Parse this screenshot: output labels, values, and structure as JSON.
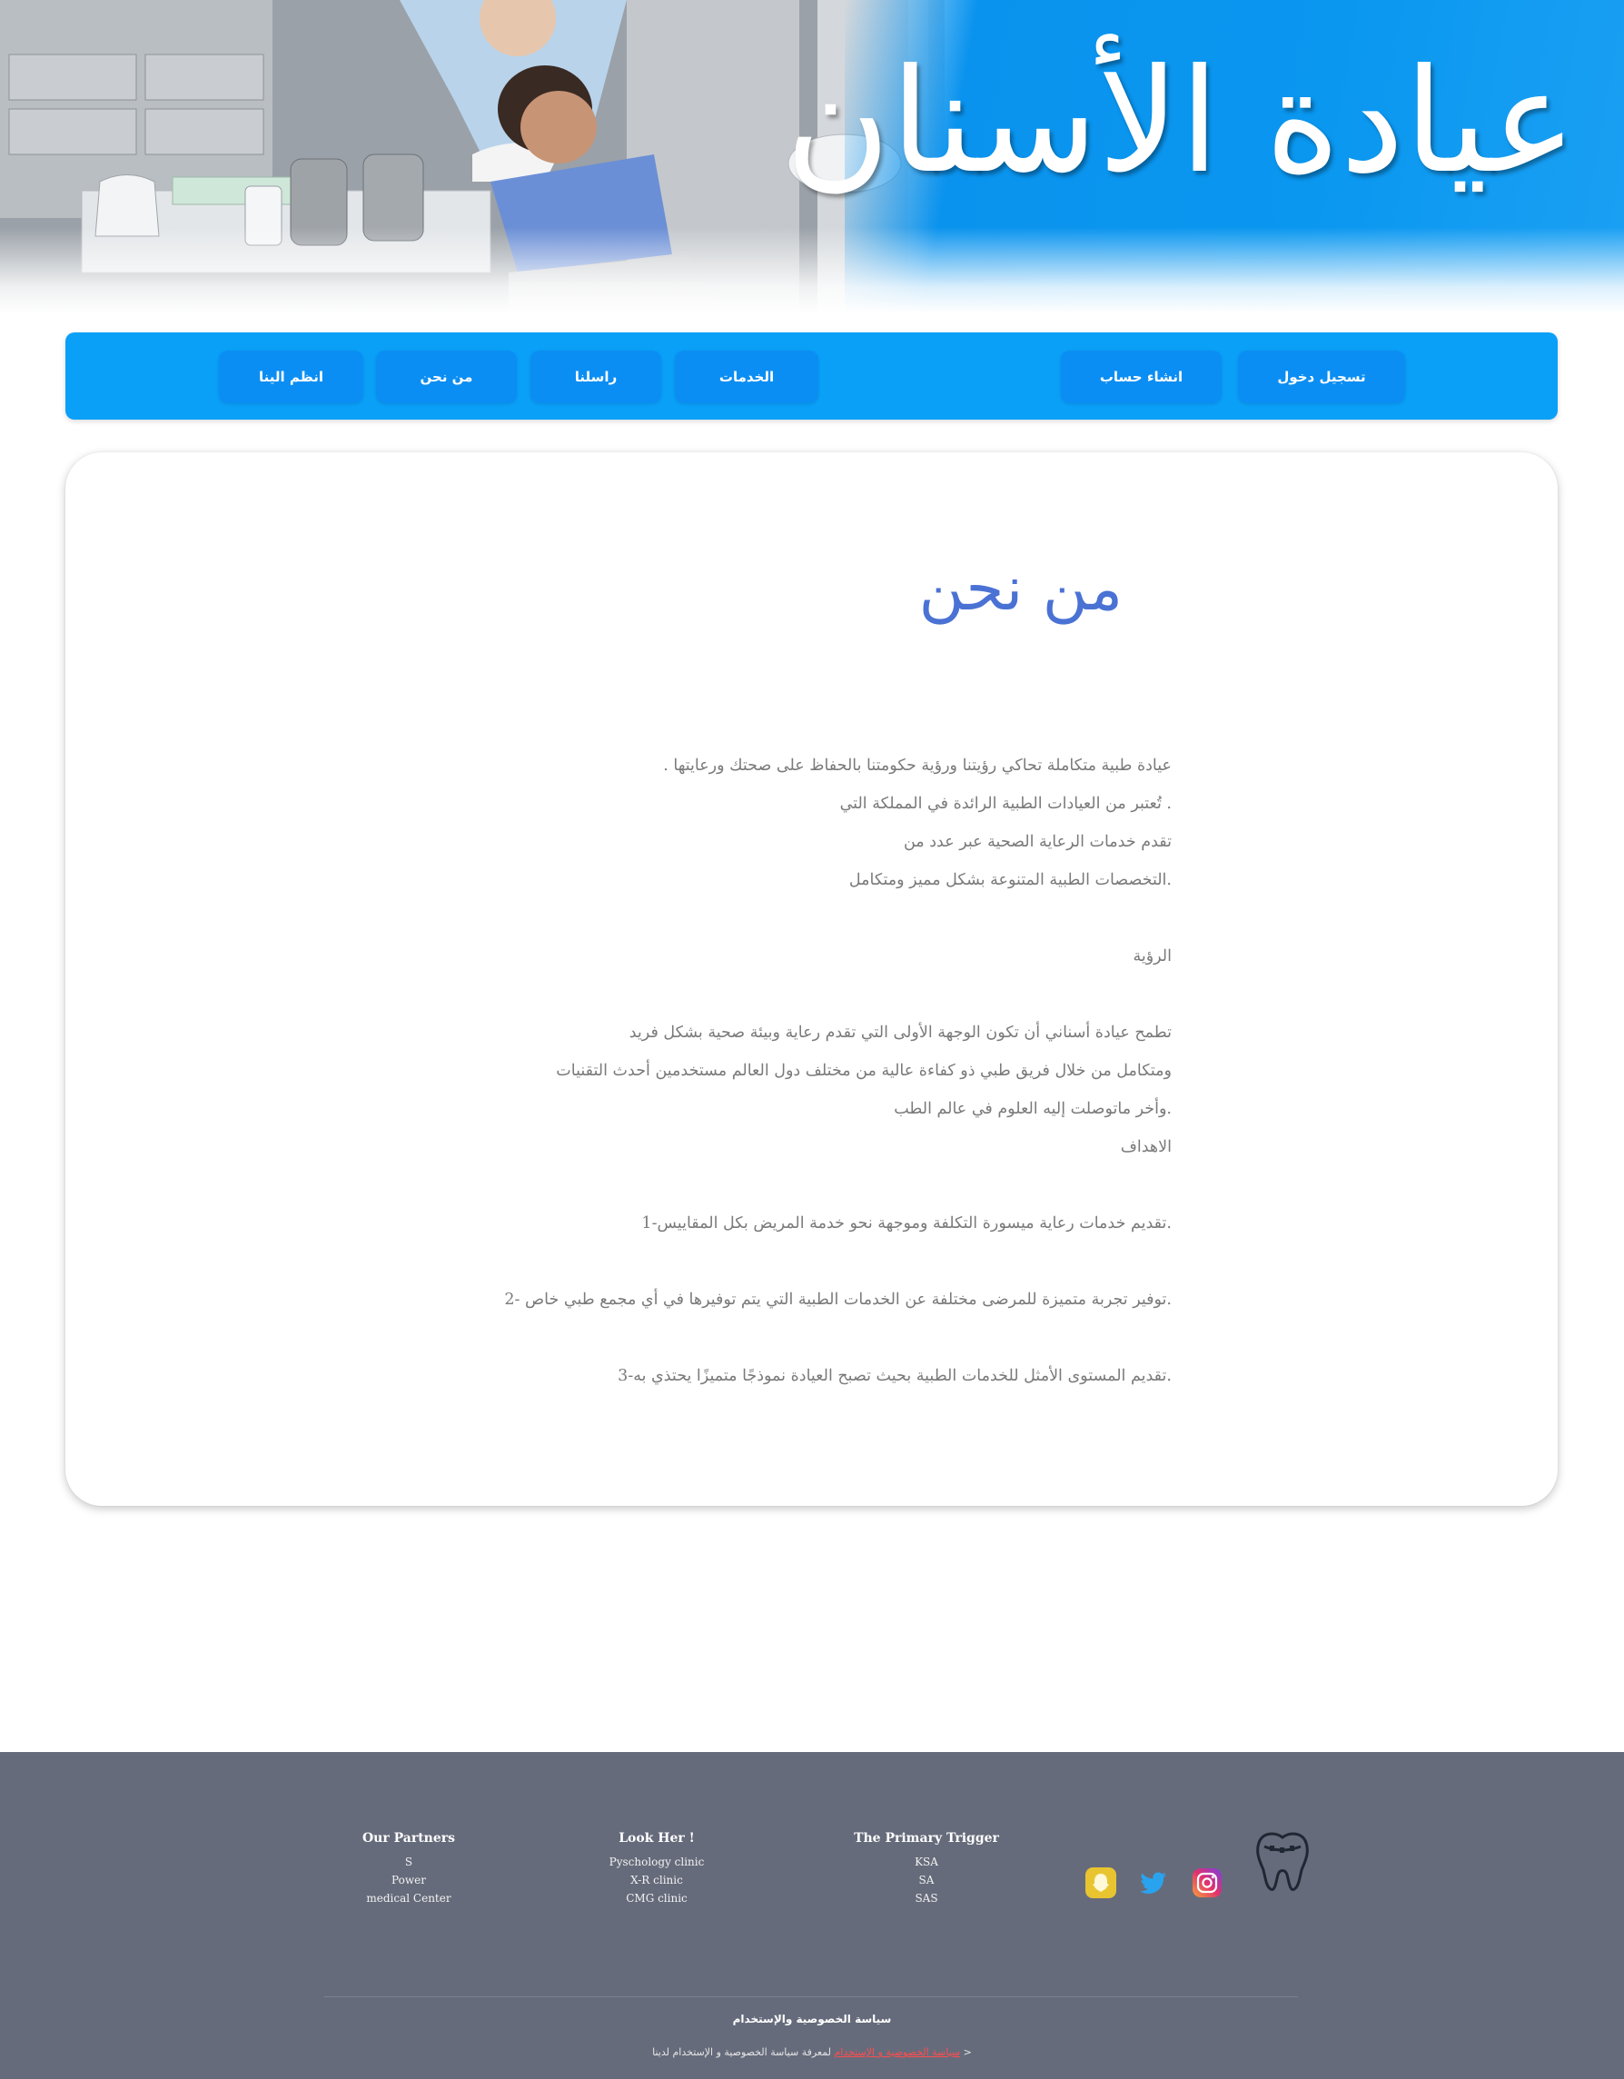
{
  "banner": {
    "title": "عيادة الأسنان",
    "image_alt": "dentist treating child patient",
    "colors": {
      "blue": "#0a97f0"
    }
  },
  "nav": {
    "login": "تسجيل دخول",
    "signup": "انشاء حساب",
    "services": "الخدمات",
    "contact": "راسلنا",
    "about": "من نحن",
    "join": "انظم الينا",
    "colors": {
      "bar": "#0aa0f8",
      "button": "#0b8ef3"
    }
  },
  "main": {
    "title": "من نحن",
    "lines": [
      ". عيادة طبية متكاملة تحاكي رؤيتنا ورؤية حكومتنا بالحفاظ على صحتك ورعايتها",
      "تُعتبر من العيادات الطبية الرائدة في المملكة التي .",
      "تقدم خدمات الرعاية الصحية عبر عدد من",
      "التخصصات الطبية المتنوعة بشكل مميز ومتكامل.",
      "الرؤية",
      "تطمح عيادة أسناني أن تكون الوجهة الأولى التي تقدم رعاية وبيئة صحية بشكل فريد",
      "ومتكامل من خلال فريق طبي ذو كفاءة عالية من مختلف دول العالم مستخدمين أحدث التقنيات",
      "وأخر ماتوصلت إليه العلوم في عالم الطب.",
      "الاهداف",
      "تقديم خدمات رعاية ميسورة التكلفة وموجهة نحو خدمة المريض بكل المقاييس-1.",
      "توفير تجربة متميزة للمرضى مختلفة عن الخدمات الطبية التي يتم توفيرها في أي مجمع طبي خاص -2.",
      "تقديم المستوى الأمثل للخدمات الطبية بحيث تصبح العيادة نموذجًا متميزًا يحتذي به-3."
    ],
    "colors": {
      "title": "#4a72d4",
      "text": "#7a7a7a"
    }
  },
  "footer": {
    "partners": {
      "title": "Our Partners",
      "items": [
        "S",
        "Power",
        "medical Center"
      ]
    },
    "look": {
      "title": "Look Her !",
      "items": [
        "Pyschology clinic",
        "X-R clinic",
        "CMG clinic"
      ]
    },
    "trigger": {
      "title": "The Primary Trigger",
      "items": [
        "KSA",
        "SA",
        "SAS"
      ]
    },
    "icons": [
      "snapchat-icon",
      "twitter-icon",
      "instagram-icon",
      "tooth-logo-icon"
    ],
    "policy_title": "سياسة الخصوصية والإستخدام",
    "policy_text": "لمعرفة سياسة الخصوصية و الإستخدام لدينا >",
    "policy_link": "سياسة الخصوصية و الإستخدام",
    "colors": {
      "background": "#666b7b",
      "link": "#ff4d4d"
    }
  }
}
